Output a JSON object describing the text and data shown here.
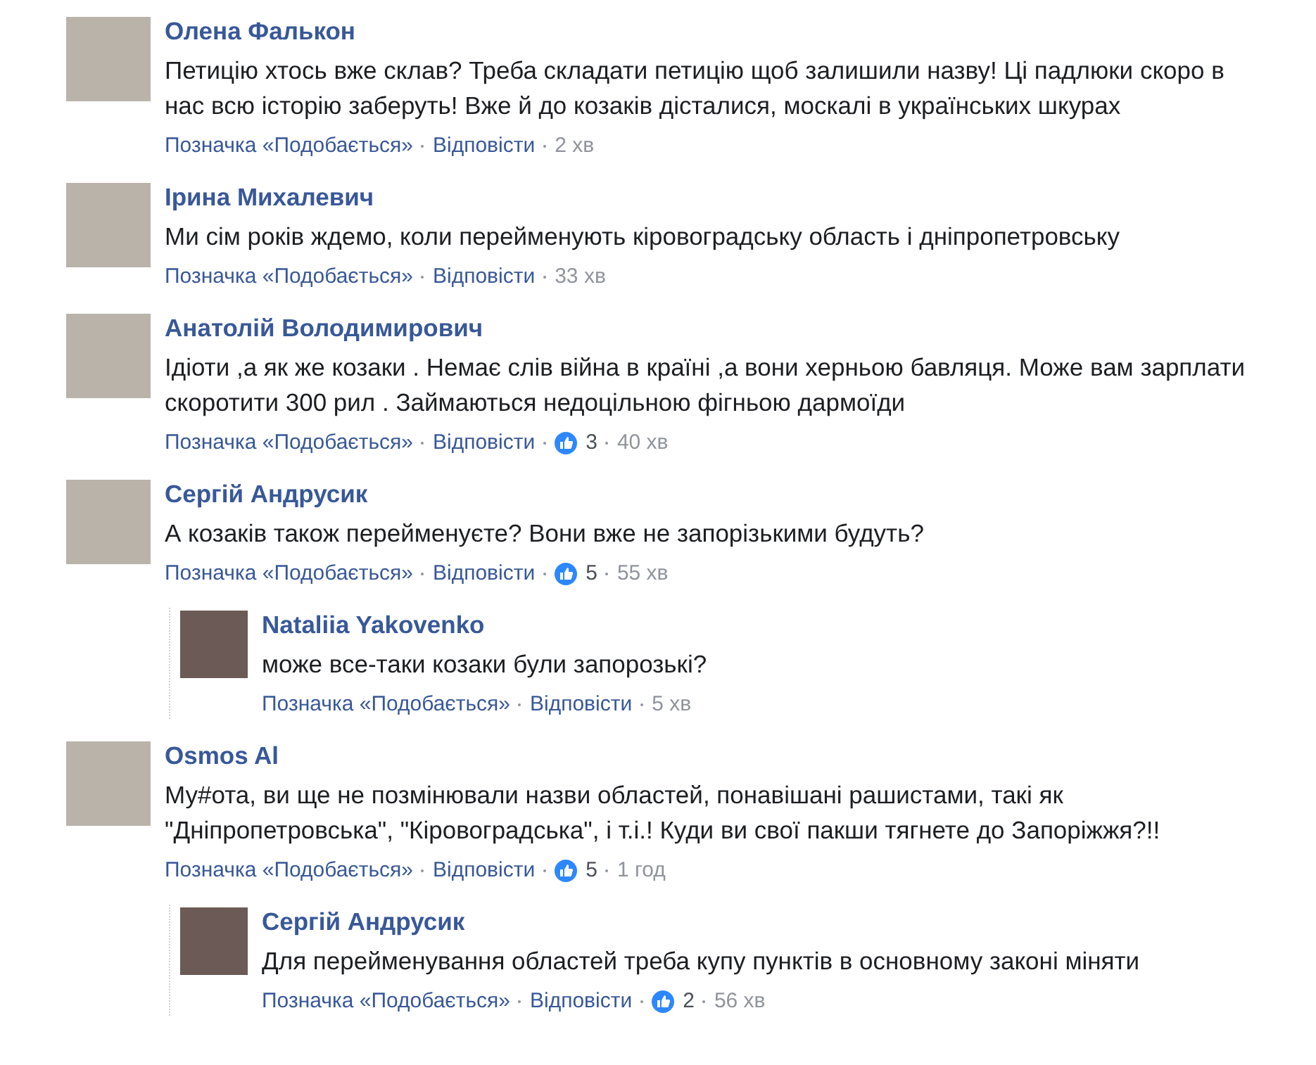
{
  "comments": [
    {
      "author": "Олена Фалькон",
      "text": "Петицію хтось вже склав? Треба складати петицію щоб залишили назву! Ці падлюки скоро в нас всю історію заберуть! Вже й до козаків дісталися, москалі в українських шкурах",
      "like_label": "Позначка «Подобається»",
      "reply_label": "Відповісти",
      "time": "2 хв"
    },
    {
      "author": "Ірина Михалевич",
      "text": "Ми сім років ждемо, коли перейменують кіровоградську область і дніпропетровську",
      "like_label": "Позначка «Подобається»",
      "reply_label": "Відповісти",
      "time": "33 хв"
    },
    {
      "author": "Анатолій Володимирович",
      "text": "Ідіоти ,а як же козаки . Немає слів війна в країні ,а вони херньою бавляця. Може вам зарплати скоротити 300 рил . Займаються недоцільною фігньою дармоїди",
      "like_label": "Позначка «Подобається»",
      "reply_label": "Відповісти",
      "likes": "3",
      "time": "40 хв"
    },
    {
      "author": "Сергій Андрусик",
      "text": "А козаків також перейменуєте? Вони вже не запорізькими будуть?",
      "like_label": "Позначка «Подобається»",
      "reply_label": "Відповісти",
      "likes": "5",
      "time": "55 хв",
      "replies": [
        {
          "author": "Nataliia Yakovenko",
          "text": "може все-таки козаки були запорозькі?",
          "like_label": "Позначка «Подобається»",
          "reply_label": "Відповісти",
          "time": "5 хв"
        }
      ]
    },
    {
      "author": "Osmos Al",
      "text": "Му#ота, ви ще не позмінювали назви областей, понавішані рашистами, такі як \"Дніпропетровська\", \"Кіровоградська\", і т.і.! Куди ви свої пакши тягнете до Запоріжжя?!!",
      "like_label": "Позначка «Подобається»",
      "reply_label": "Відповісти",
      "likes": "5",
      "time": "1 год",
      "replies": [
        {
          "author": "Сергій Андрусик",
          "text": "Для перейменування областей треба купу пунктів в основному законі міняти",
          "like_label": "Позначка «Подобається»",
          "reply_label": "Відповісти",
          "likes": "2",
          "time": "56 хв"
        }
      ]
    }
  ]
}
